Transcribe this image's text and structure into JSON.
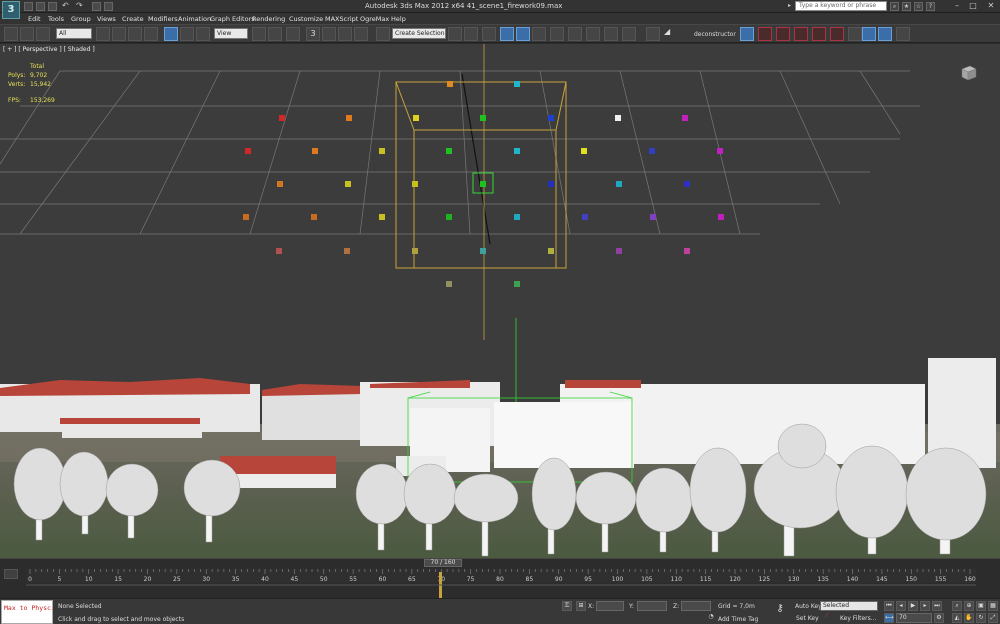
{
  "titlebar": {
    "title": "Autodesk 3ds Max  2012 x64      41_scene1_firework09.max",
    "search_placeholder": "Type a keyword or phrase",
    "logo_text": "3"
  },
  "menus": [
    "Edit",
    "Tools",
    "Group",
    "Views",
    "Create",
    "Modifiers",
    "Animation",
    "Graph Editors",
    "Rendering",
    "Customize",
    "MAXScript",
    "OgreMax",
    "Help"
  ],
  "toolbar": {
    "selection_filter": "All",
    "ref_coord": "View",
    "angle_snap": "3",
    "named_selection": "Create Selection Se",
    "deconstructor": "deconstructor"
  },
  "viewport": {
    "label": "[ + ] [ Perspective ] [ Shaded ]",
    "stats": {
      "total_label": "Total",
      "polys_label": "Polys:",
      "polys_value": "9,702",
      "verts_label": "Verts:",
      "verts_value": "15,942",
      "fps_label": "FPS:",
      "fps_value": "153,269"
    }
  },
  "timeline": {
    "slider_text": "70 / 160",
    "ticks": [
      "0",
      "5",
      "10",
      "15",
      "20",
      "25",
      "30",
      "35",
      "40",
      "45",
      "50",
      "55",
      "60",
      "65",
      "70",
      "75",
      "80",
      "85",
      "90",
      "95",
      "100",
      "105",
      "110",
      "115",
      "120",
      "125",
      "130",
      "135",
      "140",
      "145",
      "150",
      "155",
      "160"
    ]
  },
  "statusbar": {
    "maxscript": "Max to Physc.",
    "selection_status": "None Selected",
    "prompt": "Click and drag to select and move objects",
    "x_label": "X:",
    "y_label": "Y:",
    "z_label": "Z:",
    "grid": "Grid = 7,0m",
    "add_time_tag": "Add Time Tag",
    "auto_key": "Auto Key",
    "set_key": "Set Key",
    "key_mode": "Selected",
    "key_filters": "Key Filters...",
    "current_frame": "70"
  },
  "colors": {
    "grid_line": "#7a7a7a",
    "selection_box": "#c8a23c",
    "selected_wire": "#33d633",
    "stats_text": "#e8e058",
    "roof": "#b8453a",
    "active_button": "#3b6ea8"
  },
  "icons": [
    "app-logo-icon",
    "undo-icon",
    "redo-icon",
    "select-link-icon",
    "unlink-icon",
    "bind-space-warp-icon",
    "select-object-icon",
    "select-by-name-icon",
    "rect-selection-icon",
    "window-crossing-icon",
    "select-move-icon",
    "select-rotate-icon",
    "select-scale-icon",
    "pivot-icon",
    "select-manipulate-icon",
    "keyboard-shortcut-icon",
    "snap-toggle-icon",
    "angle-snap-icon",
    "percent-snap-icon",
    "spinner-snap-icon",
    "edit-named-selection-icon",
    "mirror-icon",
    "align-icon",
    "layer-manager-icon",
    "graphite-ribbon-icon",
    "curve-editor-icon",
    "schematic-view-icon",
    "material-editor-icon",
    "render-setup-icon",
    "rendered-frame-icon",
    "render-production-icon",
    "save-icon",
    "help-icon",
    "key-icon",
    "play-icon",
    "zoom-icon",
    "pan-icon",
    "orbit-icon",
    "maximize-viewport-icon"
  ]
}
